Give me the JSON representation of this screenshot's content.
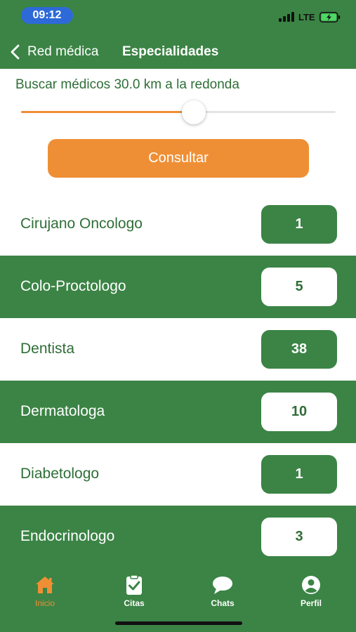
{
  "status_bar": {
    "time": "09:12",
    "network": "LTE"
  },
  "nav": {
    "back_label": "Red médica",
    "title": "Especialidades"
  },
  "search": {
    "radius_label": "Buscar médicos 30.0 km a la redonda",
    "radius_fraction": 0.55
  },
  "consult_button": "Consultar",
  "specialties": [
    {
      "name": "Cirujano Oncologo",
      "count": "1"
    },
    {
      "name": "Colo-Proctologo",
      "count": "5"
    },
    {
      "name": "Dentista",
      "count": "38"
    },
    {
      "name": "Dermatologa",
      "count": "10"
    },
    {
      "name": "Diabetologo",
      "count": "1"
    },
    {
      "name": "Endocrinologo",
      "count": "3"
    }
  ],
  "tabs": [
    {
      "label": "Inicio",
      "icon": "home-icon",
      "active": true
    },
    {
      "label": "Citas",
      "icon": "clipboard-check-icon",
      "active": false
    },
    {
      "label": "Chats",
      "icon": "chat-bubble-icon",
      "active": false
    },
    {
      "label": "Perfil",
      "icon": "user-icon",
      "active": false
    }
  ],
  "colors": {
    "primary_green": "#3b8445",
    "accent_orange": "#ef8f35",
    "text_green": "#2f6e37"
  }
}
